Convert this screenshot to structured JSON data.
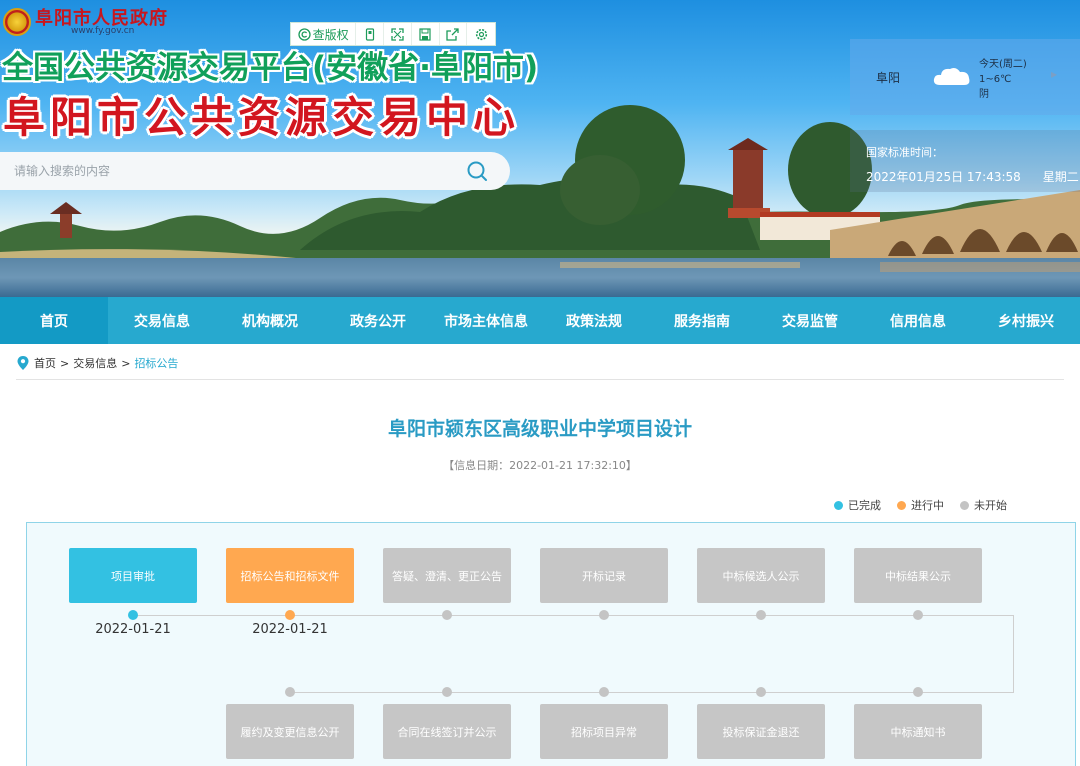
{
  "header": {
    "gov_name": "阜阳市人民政府",
    "gov_url": "www.fy.gov.cn",
    "toolbar": {
      "copyright_label": "查版权",
      "icons": [
        "copyright-icon",
        "mobile-icon",
        "fullscreen-icon",
        "save-icon",
        "share-icon",
        "settings-icon"
      ]
    },
    "title_line1": "全国公共资源交易平台(安徽省·阜阳市)",
    "title_line2": "阜阳市公共资源交易中心",
    "search": {
      "placeholder": "请输入搜索的内容"
    },
    "weather": {
      "city": "阜阳",
      "day": "今天(周二)",
      "temp": "1~6℃",
      "condition": "阴",
      "icon": "cloud-icon"
    },
    "clock": {
      "label": "国家标准时间：",
      "datetime": "2022年01月25日 17:43:58",
      "weekday": "星期二"
    }
  },
  "nav": {
    "items": [
      {
        "label": "首页",
        "active": true
      },
      {
        "label": "交易信息"
      },
      {
        "label": "机构概况"
      },
      {
        "label": "政务公开"
      },
      {
        "label": "市场主体信息"
      },
      {
        "label": "政策法规"
      },
      {
        "label": "服务指南"
      },
      {
        "label": "交易监管"
      },
      {
        "label": "信用信息"
      },
      {
        "label": "乡村振兴"
      }
    ]
  },
  "breadcrumb": {
    "items": [
      "首页",
      "交易信息",
      "招标公告"
    ],
    "separator": ">"
  },
  "article": {
    "title": "阜阳市颍东区高级职业中学项目设计",
    "date_text": "【信息日期：2022-01-21 17:32:10】"
  },
  "legend": {
    "items": [
      {
        "label": "已完成",
        "color": "#33c1e2"
      },
      {
        "label": "进行中",
        "color": "#ffa850"
      },
      {
        "label": "未开始",
        "color": "#c4c4c4"
      }
    ]
  },
  "progress": {
    "row1": [
      {
        "label": "项目审批",
        "status": "done",
        "date": "2022-01-21"
      },
      {
        "label": "招标公告和招标文件",
        "status": "doing",
        "date": "2022-01-21"
      },
      {
        "label": "答疑、澄清、更正公告",
        "status": "todo",
        "date": ""
      },
      {
        "label": "开标记录",
        "status": "todo",
        "date": ""
      },
      {
        "label": "中标候选人公示",
        "status": "todo",
        "date": ""
      },
      {
        "label": "中标结果公示",
        "status": "todo",
        "date": ""
      }
    ],
    "row2": [
      {
        "label": "履约及变更信息公开",
        "status": "todo"
      },
      {
        "label": "合同在线签订并公示",
        "status": "todo"
      },
      {
        "label": "招标项目异常",
        "status": "todo"
      },
      {
        "label": "投标保证金退还",
        "status": "todo"
      },
      {
        "label": "中标通知书",
        "status": "todo"
      }
    ]
  },
  "colors": {
    "nav_bg": "#27a9cf",
    "nav_active": "#139ac5",
    "accent": "#2a9bc4",
    "done": "#33c1e2",
    "doing": "#ffa850",
    "todo": "#c6c6c6"
  }
}
